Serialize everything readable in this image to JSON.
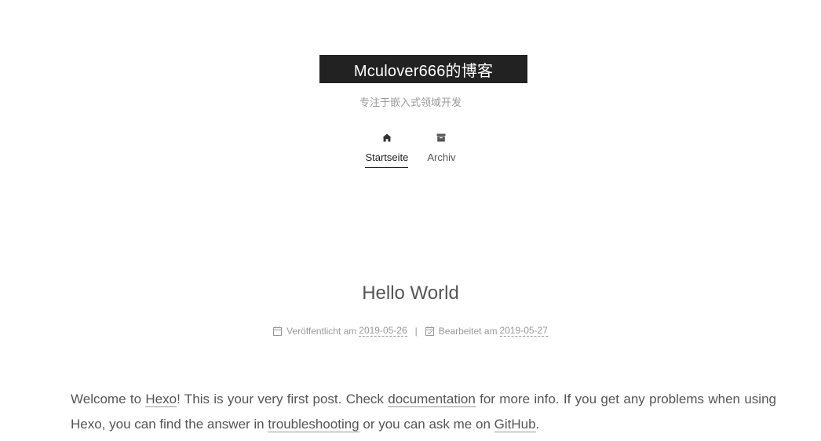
{
  "site": {
    "title": "Mculover666的博客",
    "subtitle": "专注于嵌入式领域开发"
  },
  "nav": {
    "items": [
      {
        "label": "Startseite",
        "icon": "home-icon",
        "active": true
      },
      {
        "label": "Archiv",
        "icon": "archive-icon",
        "active": false
      }
    ]
  },
  "post": {
    "title": "Hello World",
    "meta": {
      "published_label": "Veröffentlicht am",
      "published_date": "2019-05-26",
      "divider": "|",
      "edited_label": "Bearbeitet am",
      "edited_date": "2019-05-27"
    },
    "body": {
      "t1": "Welcome to ",
      "link_hexo": "Hexo",
      "t2": "! This is your very first post. Check ",
      "link_documentation": "documentation",
      "t3": " for more info. If you get any problems when using Hexo, you can find the answer in ",
      "link_troubleshooting": "troubleshooting",
      "t4": " or you can ask me on ",
      "link_github": "GitHub",
      "t5": "."
    }
  },
  "colors": {
    "brand_bg": "#222222",
    "brand_text": "#ffffff",
    "text": "#555555",
    "muted": "#999999"
  }
}
